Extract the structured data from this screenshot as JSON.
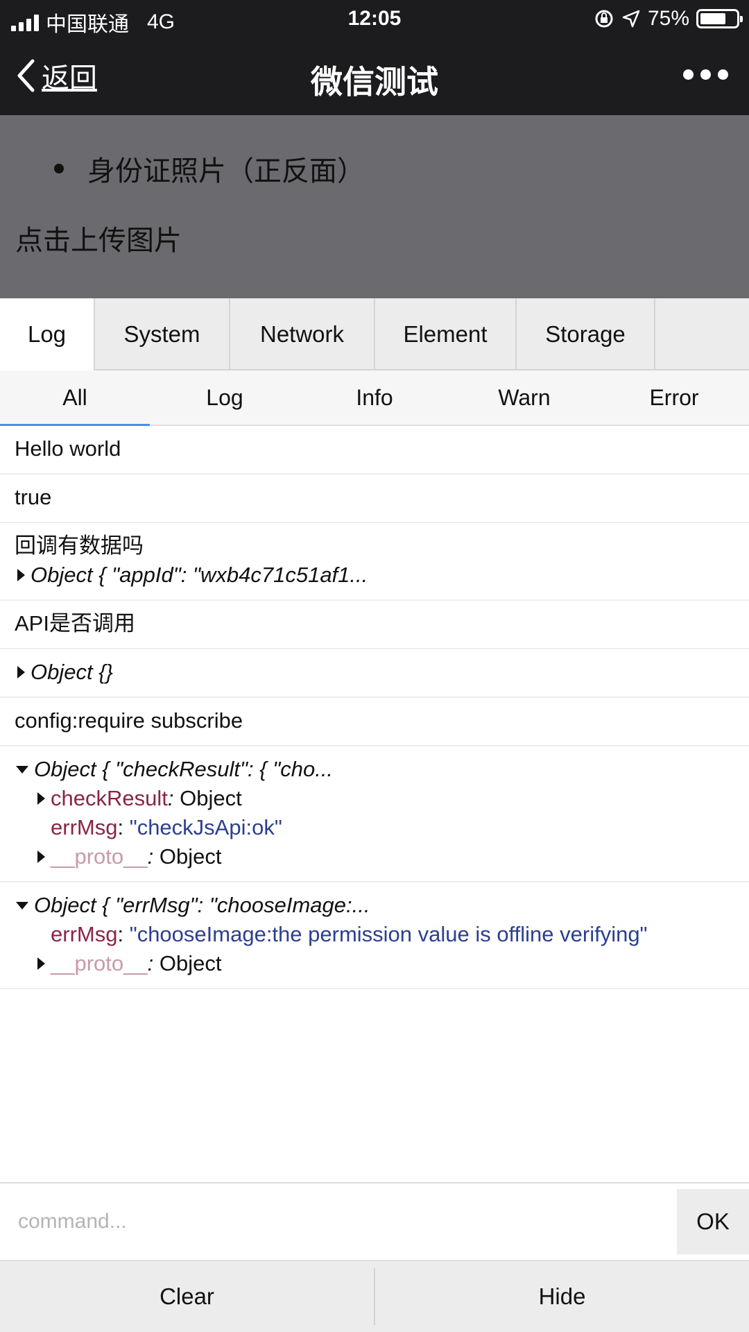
{
  "status_bar": {
    "carrier": "中国联通",
    "network": "4G",
    "time": "12:05",
    "battery_text": "75%",
    "battery_level": 0.75,
    "icons": [
      "signal-icon",
      "orientation-lock-icon",
      "location-icon",
      "battery-icon"
    ]
  },
  "nav": {
    "back_label": "返回",
    "title": "微信测试",
    "more_icon": "more-icon"
  },
  "page": {
    "bullet_text": "身份证照片（正反面）",
    "upload_text": "点击上传图片"
  },
  "tabs": [
    {
      "label": "Log",
      "active": true
    },
    {
      "label": "System"
    },
    {
      "label": "Network"
    },
    {
      "label": "Element"
    },
    {
      "label": "Storage"
    }
  ],
  "filters": [
    {
      "label": "All",
      "active": true
    },
    {
      "label": "Log"
    },
    {
      "label": "Info"
    },
    {
      "label": "Warn"
    },
    {
      "label": "Error"
    }
  ],
  "logs": [
    {
      "text": "Hello world"
    },
    {
      "text": "true"
    },
    {
      "text": "回调有数据吗",
      "object": "Object { \"appId\": \"wxb4c71c51af1..."
    },
    {
      "text": "API是否调用"
    },
    {
      "object": "Object {}"
    },
    {
      "text": "config:require subscribe"
    },
    {
      "object": "Object { \"checkResult\": { \"cho...",
      "check_key": "checkResult",
      "check_value": "Object",
      "err_key": "errMsg",
      "err_value": "\"checkJsApi:ok\"",
      "proto_key": "__proto__",
      "proto_value": "Object"
    },
    {
      "object": "Object { \"errMsg\": \"chooseImage:...",
      "err_key": "errMsg",
      "err_value": "\"chooseImage:the permission value is offline verifying\"",
      "proto_key": "__proto__",
      "proto_value": "Object"
    }
  ],
  "command": {
    "placeholder": "command...",
    "ok_label": "OK"
  },
  "bottom": {
    "clear_label": "Clear",
    "hide_label": "Hide"
  },
  "colors": {
    "bar_bg": "#1c1b1e",
    "overlay": "#6b6a6e",
    "active_indicator": "#4a8fe6",
    "key_color": "#8a2445",
    "string_color": "#2b3f8f"
  }
}
